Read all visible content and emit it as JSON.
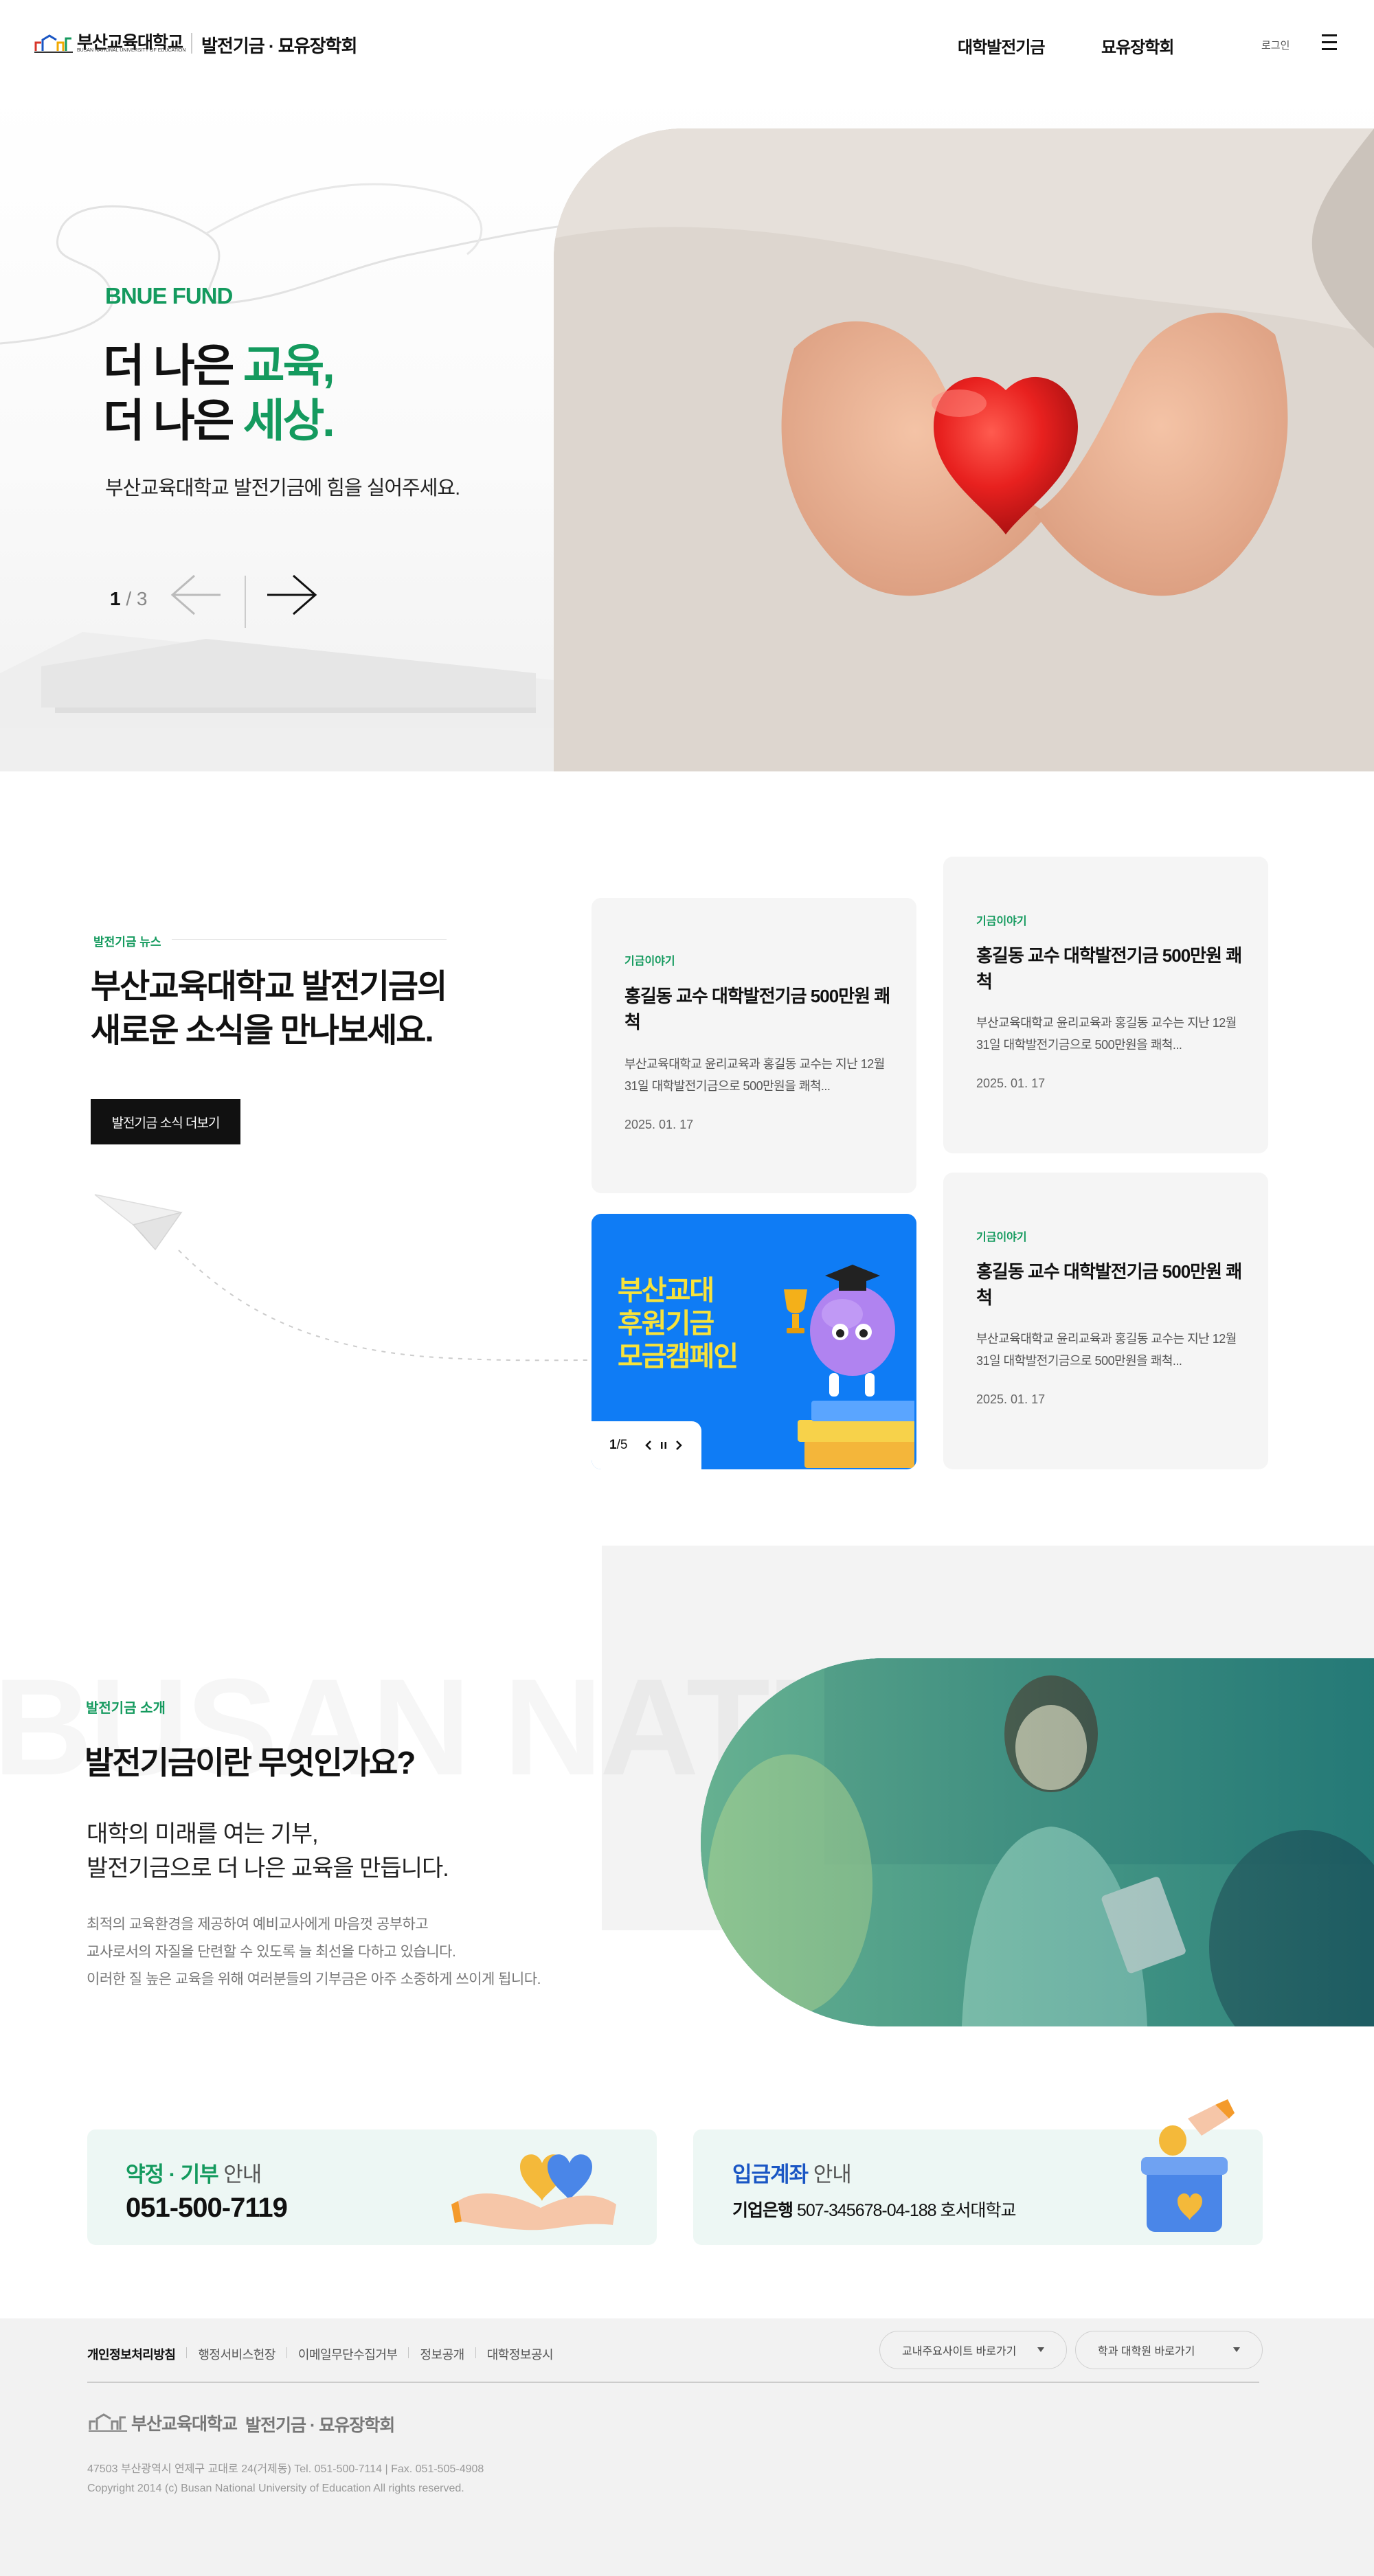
{
  "header": {
    "logo_text": "부산교육대학교",
    "logo_sub": "BUSAN NATIONAL UNIVERSITY OF EDUCATION",
    "site_name": "발전기금 · 묘유장학회",
    "nav": [
      "대학발전기금",
      "묘유장학회"
    ],
    "login": "로그인"
  },
  "hero": {
    "eyebrow": "BNUE FUND",
    "title_line1_prefix": "더 나은 ",
    "title_line1_accent": "교육,",
    "title_line2_prefix": "더 나은 ",
    "title_line2_accent": "세상.",
    "description": "부산교육대학교 발전기금에 힘을 실어주세요.",
    "counter_current": "1",
    "counter_total": "/ 3"
  },
  "news": {
    "eyebrow": "발전기금 뉴스",
    "title_line1": "부산교육대학교 발전기금의",
    "title_line2": "새로운 소식을 만나보세요.",
    "more_button": "발전기금 소식 더보기",
    "cards": [
      {
        "tag": "기금이야기",
        "title": "홍길동 교수 대학발전기금 500만원 쾌척",
        "desc": "부산교육대학교 윤리교육과 홍길동 교수는 지난 12월 31일 대학발전기금으로 500만원을 쾌척...",
        "date": "2025. 01. 17"
      },
      {
        "tag": "기금이야기",
        "title": "홍길동 교수 대학발전기금 500만원 쾌척",
        "desc": "부산교육대학교 윤리교육과 홍길동 교수는 지난 12월 31일 대학발전기금으로 500만원을 쾌척...",
        "date": "2025. 01. 17"
      },
      {
        "tag": "기금이야기",
        "title": "홍길동 교수 대학발전기금 500만원 쾌척",
        "desc": "부산교육대학교 윤리교육과 홍길동 교수는 지난 12월 31일 대학발전기금으로 500만원을 쾌척...",
        "date": "2025. 01. 17"
      }
    ],
    "promo": {
      "line1": "부산교대",
      "line2": "후원기금",
      "line3": "모금캠페인",
      "counter_current": "1",
      "counter_total": "/5"
    }
  },
  "about": {
    "watermark": "BUSAN NATI",
    "eyebrow": "발전기금 소개",
    "title": "발전기금이란 무엇인가요?",
    "sub_line1": "대학의 미래를 여는 기부,",
    "sub_line2": "발전기금으로 더 나은 교육을 만듭니다.",
    "body_line1": "최적의 교육환경을 제공하여 예비교사에게 마음껏 공부하고",
    "body_line2": "교사로서의 자질을 단련할 수 있도록 늘 최선을 다하고 있습니다.",
    "body_line3": "이러한 질 높은 교육을 위해 여러분들의 기부금은 아주 소중하게 쓰이게 됩니다."
  },
  "info": {
    "pledge": {
      "title_accent": "약정 · 기부",
      "title_rest": " 안내",
      "phone": "051-500-7119"
    },
    "account": {
      "title_accent": "입금계좌",
      "title_rest": " 안내",
      "bank": "기업은행",
      "number": " 507-345678-04-188 호서대학교"
    }
  },
  "footer": {
    "links": [
      "개인정보처리방침",
      "행정서비스헌장",
      "이메일무단수집거부",
      "정보공개",
      "대학정보공시"
    ],
    "select1": "교내주요사이트 바로가기",
    "select2": "학과 대학원 바로가기",
    "logo_text": "부산교육대학교",
    "site_name": "발전기금 · 묘유장학회",
    "address": "47503 부산광역시 연제구 교대로 24(거제동) Tel. 051-500-7114 | Fax. 051-505-4908",
    "copyright": "Copyright 2014 (c) Busan National University of Education All rights reserved."
  },
  "colors": {
    "accent_green": "#149a5e",
    "promo_blue": "#0f7cf5",
    "promo_yellow": "#f7e23b",
    "info_bg": "#edf7f4",
    "account_blue": "#1a56c4"
  },
  "icons": [
    "hamburger-icon",
    "arrow-left-icon",
    "arrow-right-icon",
    "paper-plane-icon",
    "chevron-down-icon",
    "pause-icon"
  ]
}
